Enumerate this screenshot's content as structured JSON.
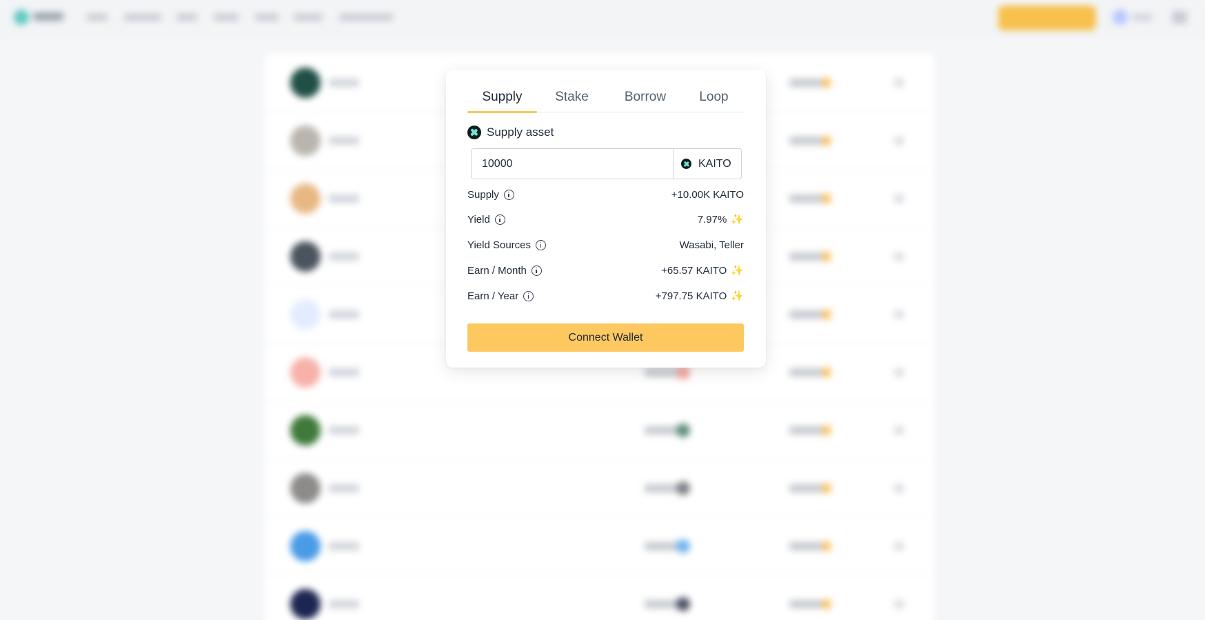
{
  "tabs": [
    {
      "label": "Supply",
      "active": true
    },
    {
      "label": "Stake",
      "active": false
    },
    {
      "label": "Borrow",
      "active": false
    },
    {
      "label": "Loop",
      "active": false
    }
  ],
  "asset": {
    "heading": "Supply asset",
    "icon": "kaito-token-icon"
  },
  "amount": {
    "value": "10000",
    "token": "KAITO"
  },
  "details": [
    {
      "label": "Supply",
      "value": "+10.00K KAITO",
      "sparkle": false
    },
    {
      "label": "Yield",
      "value": "7.97%",
      "sparkle": true
    },
    {
      "label": "Yield Sources",
      "value": "Wasabi, Teller",
      "sparkle": false
    },
    {
      "label": "Earn / Month",
      "value": "+65.57 KAITO",
      "sparkle": true
    },
    {
      "label": "Earn / Year",
      "value": "+797.75 KAITO",
      "sparkle": true
    }
  ],
  "action": {
    "label": "Connect Wallet"
  },
  "colors": {
    "accent": "#fec860",
    "tab_underline": "#f8c660",
    "sparkle": "#f5a524",
    "kaito_icon": "#6ee7d8"
  }
}
